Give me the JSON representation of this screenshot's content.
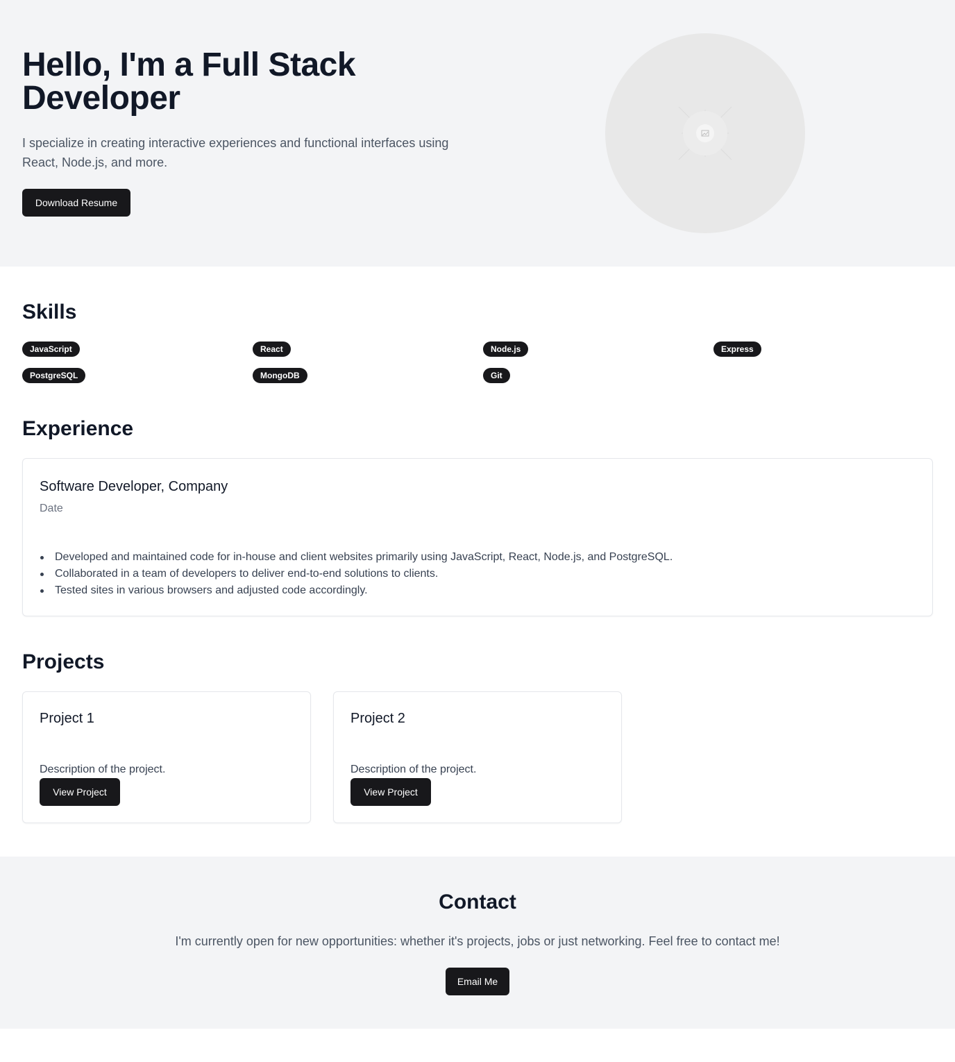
{
  "hero": {
    "title": "Hello, I'm a Full Stack Developer",
    "subtitle": "I specialize in creating interactive experiences and functional interfaces using React, Node.js, and more.",
    "resume_button": "Download Resume",
    "avatar_icon": "image-placeholder-icon"
  },
  "skills": {
    "title": "Skills",
    "items": [
      "JavaScript",
      "React",
      "Node.js",
      "Express",
      "PostgreSQL",
      "MongoDB",
      "Git"
    ]
  },
  "experience": {
    "title": "Experience",
    "role": "Software Developer, Company",
    "date": "Date",
    "bullets": [
      "Developed and maintained code for in-house and client websites primarily using JavaScript, React, Node.js, and PostgreSQL.",
      "Collaborated in a team of developers to deliver end-to-end solutions to clients.",
      "Tested sites in various browsers and adjusted code accordingly."
    ]
  },
  "projects": {
    "title": "Projects",
    "items": [
      {
        "name": "Project 1",
        "description": "Description of the project.",
        "button": "View Project"
      },
      {
        "name": "Project 2",
        "description": "Description of the project.",
        "button": "View Project"
      }
    ]
  },
  "contact": {
    "title": "Contact",
    "text": "I'm currently open for new opportunities: whether it's projects, jobs or just networking. Feel free to contact me!",
    "button": "Email Me"
  },
  "colors": {
    "primary_button": "#18181b",
    "section_bg": "#f3f4f6",
    "heading": "#111827",
    "muted_text": "#4b5563"
  }
}
